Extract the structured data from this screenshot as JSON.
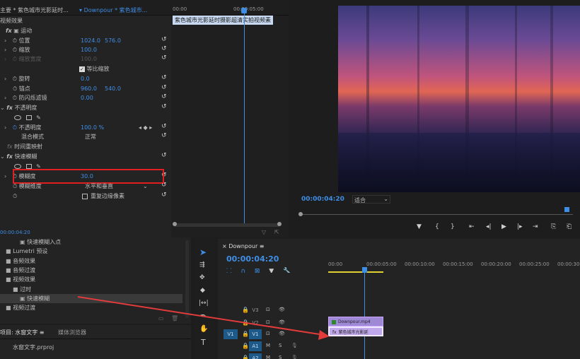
{
  "effect_controls": {
    "source_label": "主要 * 紫色城市光影延时...",
    "clip_dropdown": "Downpour * 紫色城市...",
    "section_video_effects": "视频效果",
    "motion": "运动",
    "position": {
      "label": "位置",
      "x": "1024.0",
      "y": "576.0"
    },
    "scale": {
      "label": "缩放",
      "value": "100.0"
    },
    "scale_width": {
      "label": "缩放宽度",
      "value": "100.0"
    },
    "uniform_scale": "等比缩放",
    "rotation": {
      "label": "旋转",
      "value": "0.0"
    },
    "anchor": {
      "label": "锚点",
      "x": "960.0",
      "y": "540.0"
    },
    "anti_flicker": {
      "label": "防闪烁滤镜",
      "value": "0.00"
    },
    "opacity_section": "不透明度",
    "opacity": {
      "label": "不透明度",
      "value": "100.0 %"
    },
    "blend_mode": {
      "label": "混合模式",
      "value": "正常"
    },
    "time_remap": "时间重映射",
    "fast_blur": "快速模糊",
    "blurriness": {
      "label": "模糊度",
      "value": "30.0"
    },
    "blur_dimensions": {
      "label": "模糊维度",
      "value": "水平和垂直"
    },
    "repeat_edge": "重复边缘像素",
    "timecode": "00:00:04:20",
    "mini_timeline_start": "00:00",
    "mini_timeline_mark": "00:00:05:00",
    "clip_tooltip": "紫色城市光影延时摄影超清实拍视频素"
  },
  "program_monitor": {
    "timecode": "00:00:04:20",
    "fit": "适合"
  },
  "effects_browser": {
    "items": [
      {
        "label": "快速模糊入点",
        "indent": 2
      },
      {
        "label": "Lumetri 预设",
        "indent": 0
      },
      {
        "label": "音频效果",
        "indent": 0
      },
      {
        "label": "音频过渡",
        "indent": 0
      },
      {
        "label": "视频效果",
        "indent": 0
      },
      {
        "label": "过时",
        "indent": 1
      },
      {
        "label": "快速模糊",
        "indent": 2
      },
      {
        "label": "视频过渡",
        "indent": 0
      }
    ],
    "project_tab": "项目: 水窗文字",
    "media_tab": "媒体浏览器",
    "project_file": "水窗文字.prproj"
  },
  "timeline": {
    "sequence": "Downpour",
    "timecode": "00:00:04:20",
    "ruler": [
      "00:00",
      "00:00:05:00",
      "00:00:10:00",
      "00:00:15:00",
      "00:00:20:00",
      "00:00:25:00",
      "00:00:30:00"
    ],
    "tracks": [
      "V3",
      "V2",
      "V1",
      "A1",
      "A2"
    ],
    "source_v1": "V1",
    "clip_top": "Downpour.mp4",
    "clip_bottom": "紫色城市光影延",
    "mute": "M",
    "solo": "S"
  },
  "colors": {
    "accent": "#3f8ee6",
    "highlight_box": "#e02020",
    "clip": "#a48fd6",
    "arrow": "#e23b3b"
  }
}
